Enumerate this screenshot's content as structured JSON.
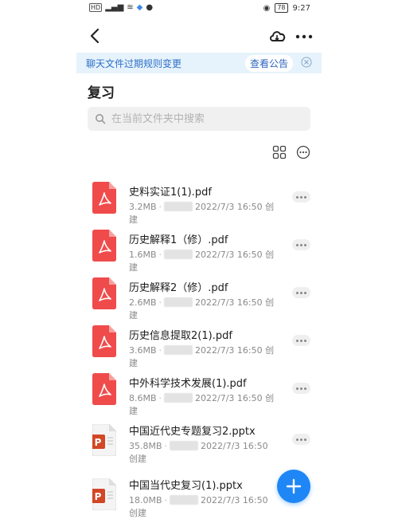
{
  "status_bar": {
    "signal_left": "4G",
    "signal_right": "4G",
    "battery": "78",
    "time": "9:27"
  },
  "banner": {
    "text": "聊天文件过期规则变更",
    "link": "查看公告"
  },
  "page": {
    "title": "复习"
  },
  "search": {
    "placeholder": "在当前文件夹中搜索"
  },
  "files": [
    {
      "name": "史料实证1(1).pdf",
      "size": "3.2MB",
      "date": "2022/7/3 16:50 创建",
      "type": "pdf"
    },
    {
      "name": "历史解释1（修）.pdf",
      "size": "1.6MB",
      "date": "2022/7/3 16:50 创建",
      "type": "pdf"
    },
    {
      "name": "历史解释2（修）.pdf",
      "size": "2.6MB",
      "date": "2022/7/3 16:50 创建",
      "type": "pdf"
    },
    {
      "name": "历史信息提取2(1).pdf",
      "size": "3.6MB",
      "date": "2022/7/3 16:50 创建",
      "type": "pdf"
    },
    {
      "name": "中外科学技术发展(1).pdf",
      "size": "8.6MB",
      "date": "2022/7/3 16:50 创建",
      "type": "pdf"
    },
    {
      "name": "中国近代史专题复习2.pptx",
      "size": "35.8MB",
      "date": "2022/7/3 16:50 创建",
      "type": "pptx"
    },
    {
      "name": "中国当代史复习(1).pptx",
      "size": "18.0MB",
      "date": "2022/7/3 16:50 创建",
      "type": "pptx"
    }
  ],
  "colors": {
    "accent": "#1f86f5",
    "pdf": "#f04b4b",
    "pptx": "#d24726",
    "banner_bg": "#e6f3fc"
  }
}
